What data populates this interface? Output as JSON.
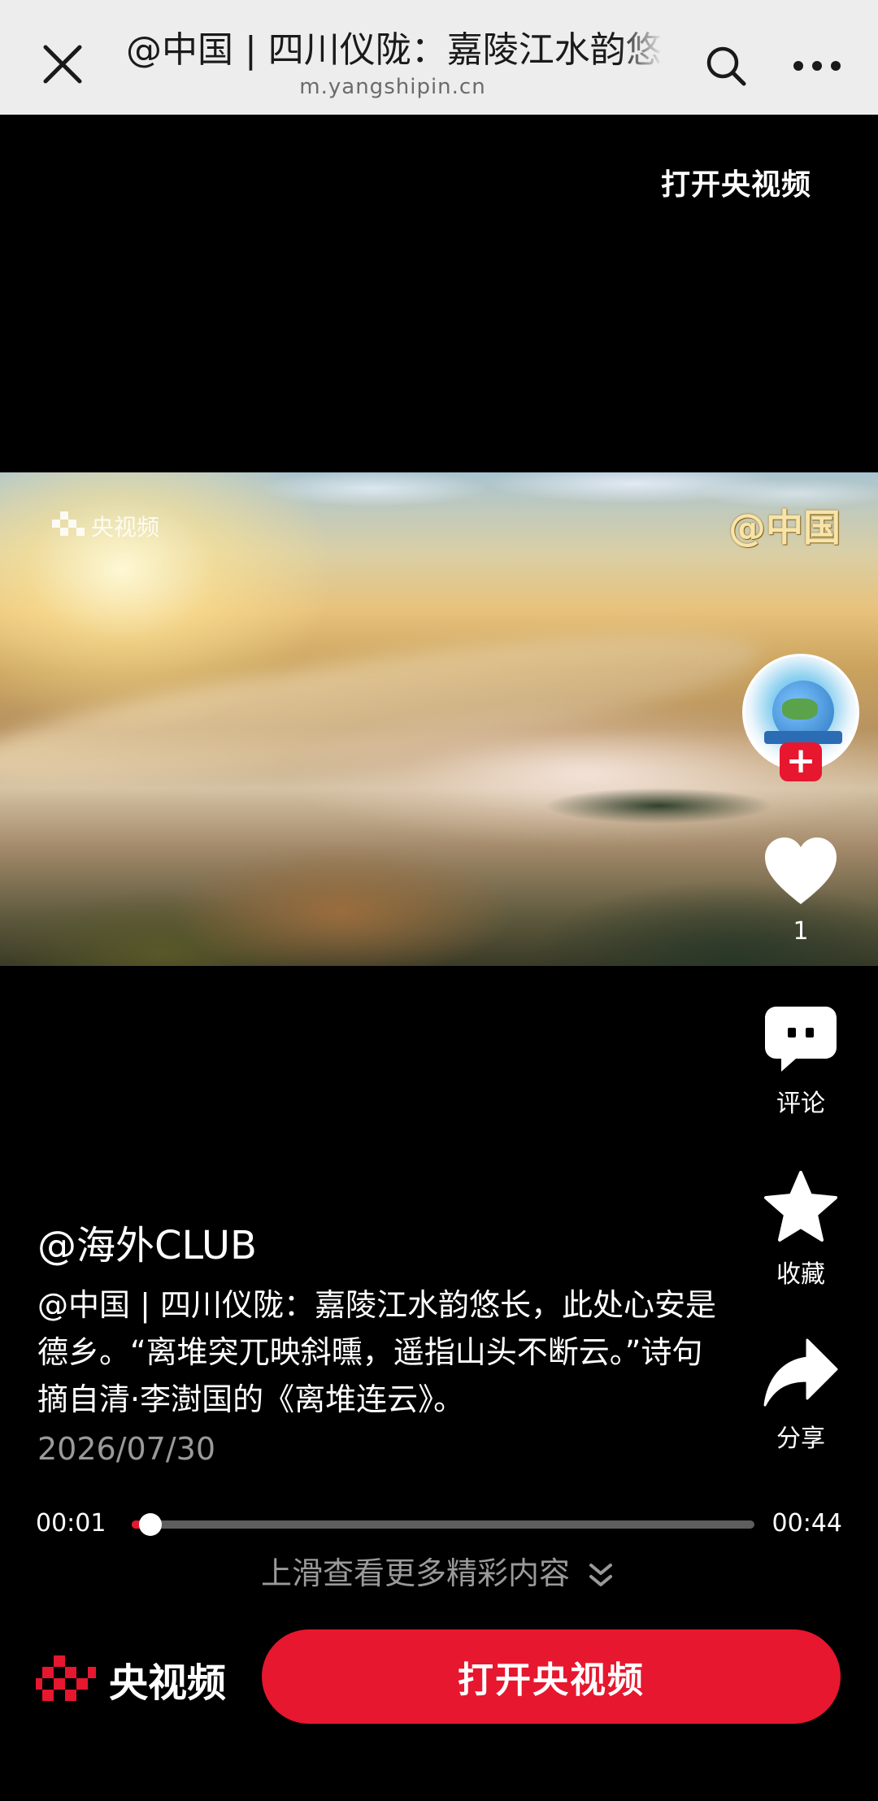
{
  "browser": {
    "title": "@中国 | 四川仪陇：嘉陵江水韵悠",
    "url": "m.yangshipin.cn"
  },
  "header": {
    "open_app_label": "打开央视频"
  },
  "video": {
    "watermark_left": "央视频",
    "watermark_right": "@中国"
  },
  "actions": {
    "follow_symbol": "+",
    "like_count": "1",
    "comment_label": "评论",
    "favorite_label": "收藏",
    "share_label": "分享"
  },
  "post": {
    "author": "@海外CLUB",
    "description": "@中国 | 四川仪陇：嘉陵江水韵悠长，此处心安是德乡。“离堆突兀映斜曛，遥指山头不断云。”诗句摘自清·李澍国的《离堆连云》。",
    "date": "2026/07/30"
  },
  "player": {
    "current_time": "00:01",
    "total_time": "00:44",
    "progress": 0.03
  },
  "hint": {
    "more_label": "上滑查看更多精彩内容"
  },
  "footer": {
    "brand_name": "央视频",
    "open_button_label": "打开央视频"
  },
  "colors": {
    "accent": "#e6172e",
    "background": "#000000",
    "topbar": "#ededed"
  }
}
